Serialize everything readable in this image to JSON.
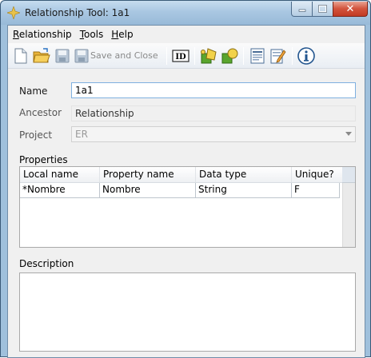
{
  "window": {
    "title": "Relationship Tool: 1a1"
  },
  "menu": [
    {
      "label": "Relationship",
      "mnemonic": "R",
      "rest": "elationship"
    },
    {
      "label": "Tools",
      "mnemonic": "T",
      "rest": "ools"
    },
    {
      "label": "Help",
      "mnemonic": "H",
      "rest": "elp"
    }
  ],
  "toolbar": {
    "save_close_label": "Save and Close"
  },
  "form": {
    "name_label": "Name",
    "name_value": "1a1",
    "ancestor_label": "Ancestor",
    "ancestor_value": "Relationship",
    "project_label": "Project",
    "project_value": "ER"
  },
  "properties": {
    "section_label": "Properties",
    "columns": [
      "Local name",
      "Property name",
      "Data type",
      "Unique?"
    ],
    "rows": [
      [
        "*Nombre",
        "Nombre",
        "String",
        "F"
      ]
    ]
  },
  "description": {
    "section_label": "Description",
    "value": ""
  },
  "icons": [
    "app-icon",
    "minimize-icon",
    "maximize-icon",
    "close-icon",
    "new-document-icon",
    "open-folder-icon",
    "save-icon",
    "save-close-icon",
    "id-icon",
    "add-shapes-icon",
    "shapes-icon",
    "form-icon",
    "edit-icon",
    "info-icon"
  ]
}
